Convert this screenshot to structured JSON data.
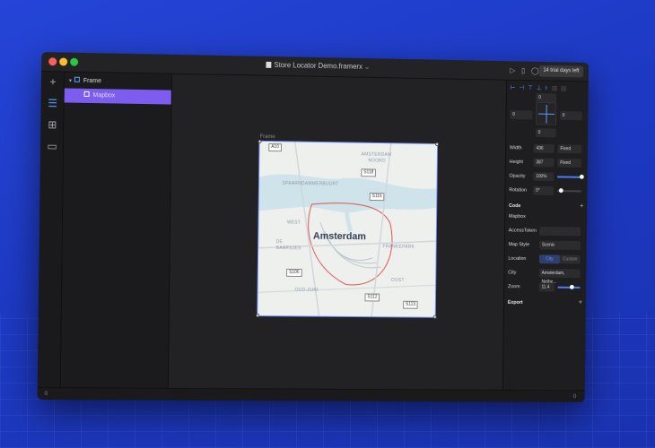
{
  "window": {
    "title": "Store Locator Demo.framerx",
    "trial_badge": "14 trial days left"
  },
  "toolbar": {
    "icons": [
      "play-icon",
      "device-icon",
      "comment-icon"
    ]
  },
  "rail": {
    "icons": [
      "plus-icon",
      "layers-icon",
      "grid-icon",
      "store-icon"
    ]
  },
  "layers": {
    "items": [
      {
        "label": "Frame",
        "icon": "frame-icon"
      },
      {
        "label": "Mapbox",
        "icon": "component-icon",
        "selected": true
      }
    ]
  },
  "canvas": {
    "frame_label": "Frame",
    "map": {
      "city_label": "Amsterdam",
      "districts": [
        "AMSTERDAM NOORD",
        "SPAARNDAMMERBUURT",
        "WEST",
        "DE BAARSJES",
        "OUD-ZUID",
        "OOST",
        "INDISCHE BUURT",
        "OOSTELIJK HAVENGEBIED"
      ],
      "district_labels_visible": [
        "AMSTERDAM",
        "NOORD",
        "SPAARNDAMMERBUURT",
        "WEST",
        "DE",
        "BAARSJES",
        "OUD-ZUID",
        "OOST",
        "FRANKEPARK"
      ],
      "shields": [
        "A10",
        "S118",
        "S116",
        "S106",
        "S112",
        "S113"
      ]
    }
  },
  "properties": {
    "position": {
      "top": "0",
      "left": "0",
      "right": "0",
      "bottom": "0"
    },
    "width": {
      "label": "Width",
      "value": "436",
      "mode": "Fixed"
    },
    "height": {
      "label": "Height",
      "value": "387",
      "mode": "Fixed"
    },
    "opacity": {
      "label": "Opacity",
      "value": "100%",
      "level": 1.0
    },
    "rotation": {
      "label": "Rotation",
      "value": "0°",
      "level": 0.0
    },
    "code_section": "Code",
    "component_name": "Mapbox",
    "access_token_label": "AccessToken",
    "map_style": {
      "label": "Map Style",
      "value": "Scenic"
    },
    "location": {
      "label": "Location",
      "options": [
        "City",
        "Custom"
      ],
      "selected": "City"
    },
    "city": {
      "label": "City",
      "value": "Amsterdam, Nethe..."
    },
    "zoom": {
      "label": "Zoom",
      "value": "11.4",
      "level": 0.6
    },
    "export_section": "Export"
  },
  "statusbar": {
    "left": "0",
    "right": "0"
  },
  "colors": {
    "accent": "#7d5cf0",
    "link_blue": "#4a7dff",
    "background": "#2545d8"
  }
}
